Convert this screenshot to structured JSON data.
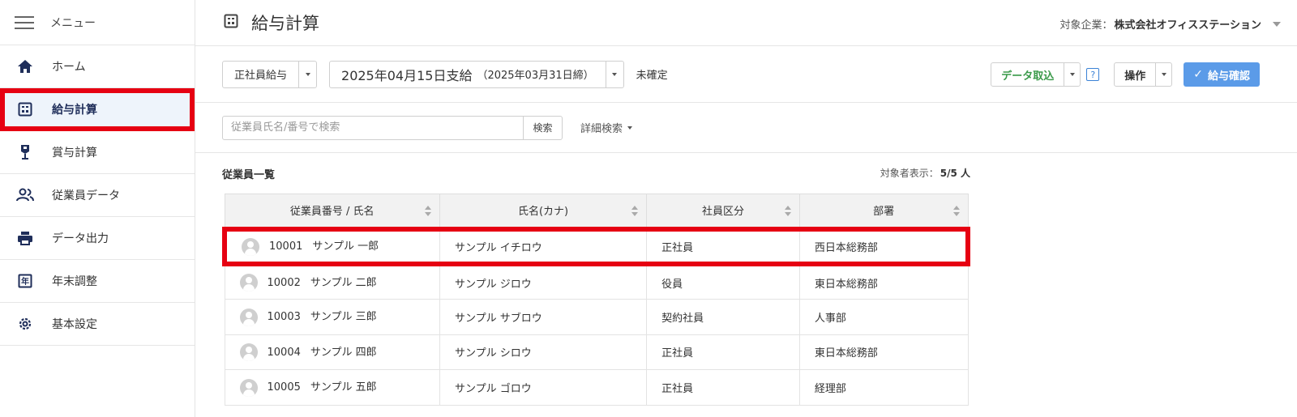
{
  "sidebar": {
    "menu_label": "メニュー",
    "items": [
      {
        "label": "ホーム",
        "icon": "home-icon"
      },
      {
        "label": "給与計算",
        "icon": "calculator-icon"
      },
      {
        "label": "賞与計算",
        "icon": "award-icon"
      },
      {
        "label": "従業員データ",
        "icon": "people-icon"
      },
      {
        "label": "データ出力",
        "icon": "printer-icon"
      },
      {
        "label": "年末調整",
        "icon": "year-calendar-icon"
      },
      {
        "label": "基本設定",
        "icon": "gear-icon"
      }
    ],
    "active_index": 1
  },
  "header": {
    "title": "給与計算",
    "company_label": "対象企業：",
    "company_name": "株式会社オフィスステーション"
  },
  "toolbar": {
    "payroll_type": "正社員給与",
    "payday": "2025年04月15日支給",
    "closing": "（2025年03月31日締）",
    "status": "未確定",
    "import_label": "データ取込",
    "help_label": "?",
    "operation_label": "操作",
    "confirm_label": "給与確認"
  },
  "search": {
    "placeholder": "従業員氏名/番号で検索",
    "button_label": "検索",
    "advanced_label": "詳細検索"
  },
  "list": {
    "title": "従業員一覧",
    "count_label": "対象者表示：",
    "count_value": "5/5 人",
    "columns": [
      "従業員番号 / 氏名",
      "氏名(カナ)",
      "社員区分",
      "部署"
    ],
    "rows": [
      {
        "no": "10001",
        "name": "サンプル 一郎",
        "kana": "サンプル イチロウ",
        "type": "正社員",
        "dept": "西日本総務部"
      },
      {
        "no": "10002",
        "name": "サンプル 二郎",
        "kana": "サンプル ジロウ",
        "type": "役員",
        "dept": "東日本総務部"
      },
      {
        "no": "10003",
        "name": "サンプル 三郎",
        "kana": "サンプル サブロウ",
        "type": "契約社員",
        "dept": "人事部"
      },
      {
        "no": "10004",
        "name": "サンプル 四郎",
        "kana": "サンプル シロウ",
        "type": "正社員",
        "dept": "東日本総務部"
      },
      {
        "no": "10005",
        "name": "サンプル 五郎",
        "kana": "サンプル ゴロウ",
        "type": "正社員",
        "dept": "経理部"
      }
    ]
  },
  "colors": {
    "accent_navy": "#1f2e5a",
    "highlight_red": "#e60012",
    "confirm_blue": "#5b9be8",
    "import_green": "#3a9a4a"
  }
}
